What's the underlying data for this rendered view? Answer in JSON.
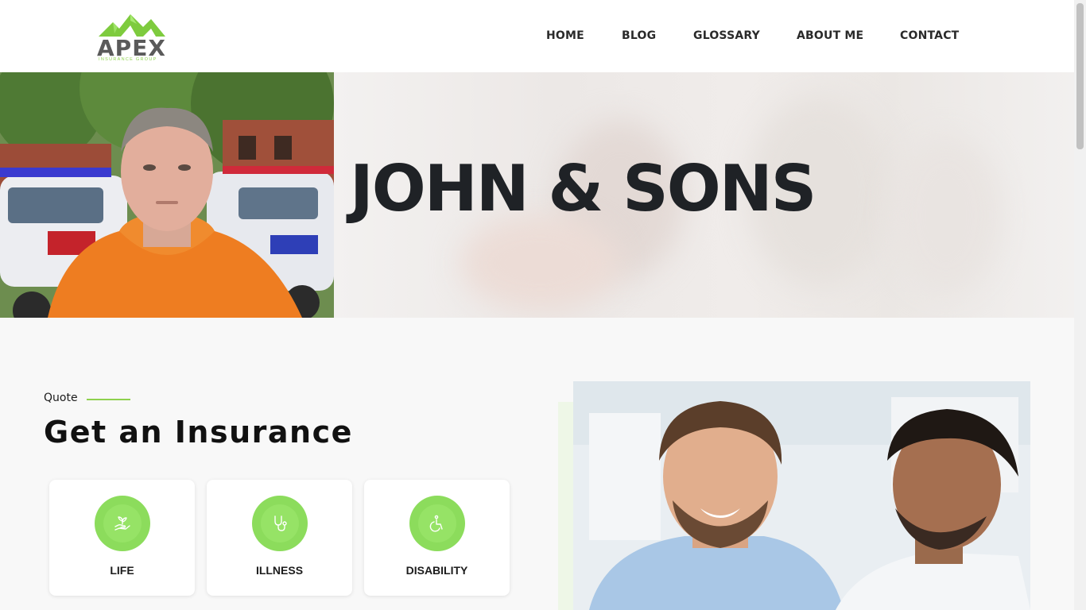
{
  "brand": {
    "name": "APEX",
    "tagline": "INSURANCE GROUP",
    "accent_color": "#8ed14e"
  },
  "nav": {
    "items": [
      {
        "label": "HOME"
      },
      {
        "label": "BLOG"
      },
      {
        "label": "GLOSSARY"
      },
      {
        "label": "ABOUT ME"
      },
      {
        "label": "CONTACT"
      }
    ]
  },
  "hero": {
    "title": "JOHN & SONS",
    "photo_icon": "agent-portrait-photo"
  },
  "quote": {
    "label": "Quote",
    "title": "Get an Insurance",
    "cards": [
      {
        "label": "LIFE",
        "icon": "plant-in-hand-icon"
      },
      {
        "label": "ILLNESS",
        "icon": "stethoscope-icon"
      },
      {
        "label": "DISABILITY",
        "icon": "wheelchair-icon"
      }
    ]
  },
  "side_photo": {
    "icon": "two-smiling-men-photo"
  }
}
